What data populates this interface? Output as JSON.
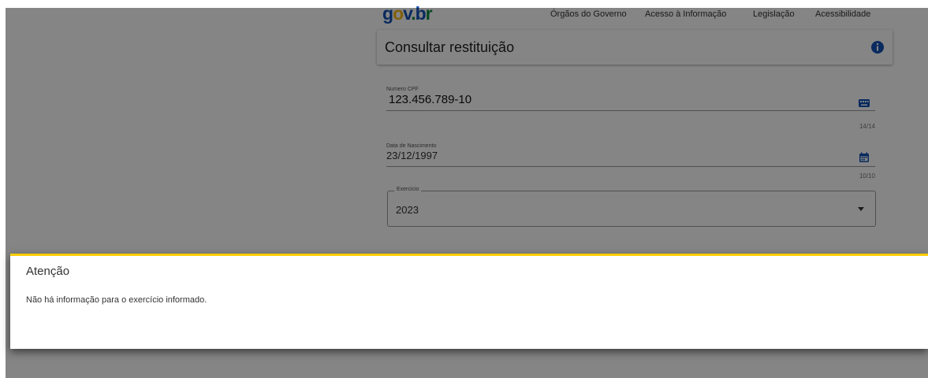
{
  "header": {
    "logo_text": "gov.br",
    "nav": [
      "Órgãos do Governo",
      "Acesso à Informação",
      "Legislação",
      "Acessibilidade"
    ]
  },
  "page": {
    "title": "Consultar restituição"
  },
  "form": {
    "cpf": {
      "label": "Numero CPF",
      "value": "123.456.789-10",
      "counter": "14/14"
    },
    "nascimento": {
      "label": "Data de Nascimento",
      "value": "23/12/1997",
      "counter": "10/10"
    },
    "exercicio": {
      "label": "Exercicio",
      "value": "2023"
    }
  },
  "alert": {
    "title": "Atenção",
    "message": "Não há informação para o exercício informado."
  },
  "colors": {
    "gov_blue": "#1351b4",
    "gov_yellow": "#f9b916",
    "gov_green": "#0c8a3c",
    "alert_accent": "#ffcd07"
  },
  "icons": [
    "info-icon",
    "keyboard-icon",
    "calendar-icon",
    "dropdown-caret-icon"
  ]
}
